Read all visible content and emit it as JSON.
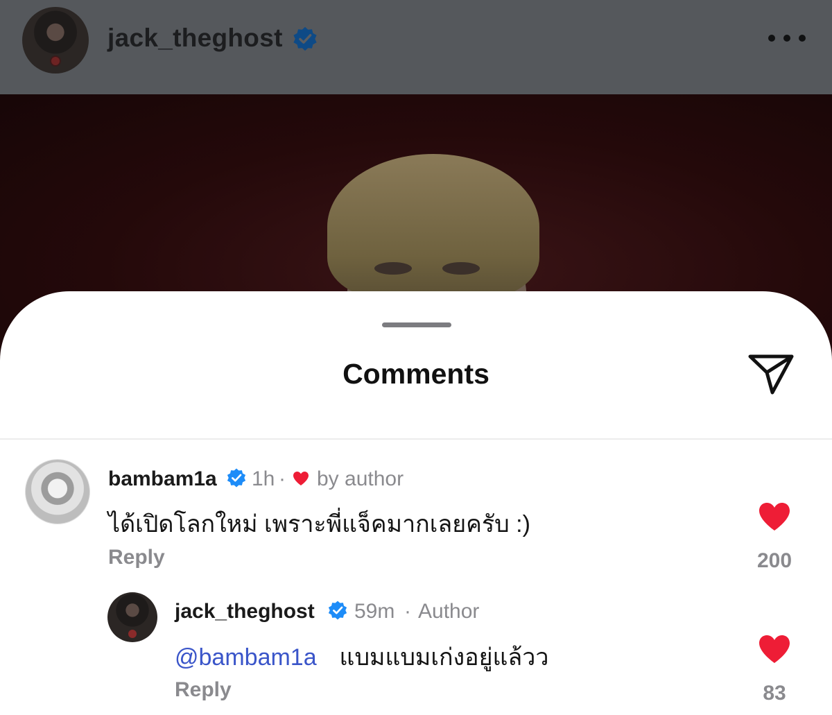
{
  "post": {
    "username": "jack_theghost"
  },
  "sheet": {
    "title": "Comments"
  },
  "comments": [
    {
      "username": "bambam1a",
      "time": "1h",
      "separator": "·",
      "liked_by_author": "by author",
      "text": "ได้เปิดโลกใหม่ เพราะพี่แจ็คมากเลยครับ :)",
      "reply_label": "Reply",
      "likes": "200"
    },
    {
      "username": "jack_theghost",
      "time": "59m",
      "separator": "·",
      "author_tag": "Author",
      "mention": "@bambam1a",
      "text": "แบมแบมเก่งอยู่แล้วว",
      "reply_label": "Reply",
      "likes": "83"
    }
  ],
  "colors": {
    "verified": "#1d8cf8",
    "heart": "#ee1d36",
    "mention": "#3a55c9"
  },
  "icons": [
    "verified-icon",
    "more-options-icon",
    "send-icon",
    "heart-icon"
  ]
}
